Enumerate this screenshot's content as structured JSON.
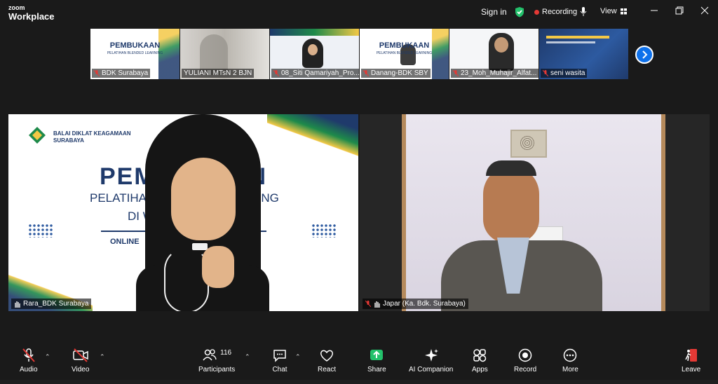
{
  "app": {
    "brand_top": "zoom",
    "brand_bottom": "Workplace"
  },
  "titlebar": {
    "signin": "Sign in",
    "recording": "Recording",
    "view": "View"
  },
  "strip": [
    {
      "label": "BDK Surabaya",
      "slide": "PEMBUKAAN",
      "sub": "PELATIHAN BLENDED LEARNING",
      "muted": true
    },
    {
      "label": "YULIANI MTsN 2 BJN",
      "muted": false
    },
    {
      "label": "08_Siti Qamariyah_Pro...",
      "muted": true
    },
    {
      "label": "Danang-BDK SBY",
      "slide": "PEMBUKAAN",
      "sub": "PELATIHAN BLENDED LEARNING",
      "muted": true
    },
    {
      "label": "23_Moh_Muhajir_Alfat...",
      "muted": true
    },
    {
      "label": "seni wasita",
      "muted": true
    }
  ],
  "main": [
    {
      "label": "Rara_BDK Surabaya",
      "org_line1": "BALAI DIKLAT KEAGAMAAN",
      "org_line2": "SURABAYA",
      "slide_title": "PEMBUKAAN",
      "slide_sub": "PELATIHAN BLENDED LEARNING",
      "slide_sub2": "DI WILAYAH KERJA",
      "slide_online": "ONLINE"
    },
    {
      "label": "Japar (Ka. Bdk. Surabaya)"
    }
  ],
  "toolbar": {
    "audio": "Audio",
    "video": "Video",
    "participants": "Participants",
    "participants_count": "116",
    "chat": "Chat",
    "react": "React",
    "share": "Share",
    "ai": "AI Companion",
    "apps": "Apps",
    "record": "Record",
    "more": "More",
    "leave": "Leave"
  },
  "colors": {
    "accent": "#0e71eb",
    "share": "#23c16b",
    "mute": "#e53935"
  }
}
